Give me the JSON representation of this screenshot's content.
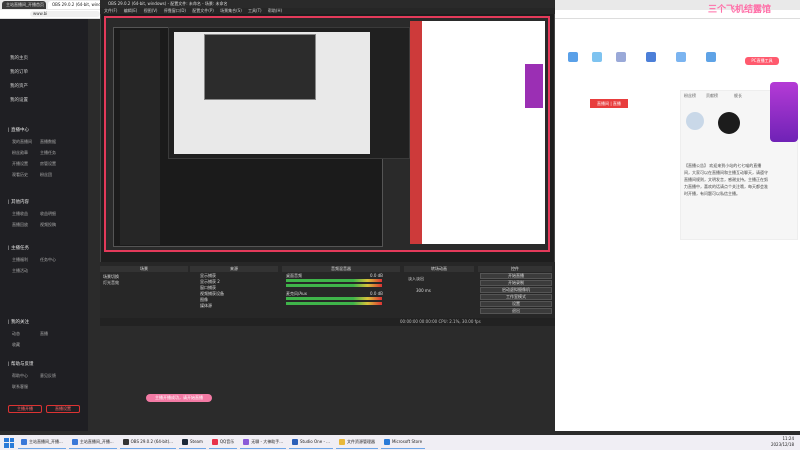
{
  "browser": {
    "tabs": [
      "主站直播间_开播首页",
      "OBS 29.0.2 (64-bit, windows)",
      "3人在线"
    ],
    "url": "www.bi",
    "title": "OBS 29.0.2 (64-bit, windows) - 配置文件: 未命名 - 场景: 未命名"
  },
  "obs_menu": [
    "文件(F)",
    "编辑(E)",
    "视图(V)",
    "停靠窗口(D)",
    "配置文件(P)",
    "场景集合(S)",
    "工具(T)",
    "帮助(H)"
  ],
  "sidebar": {
    "top_items": [
      "我的主页",
      "我的订单",
      "我的资产",
      "我的设置"
    ],
    "sections": [
      {
        "head": "| 直播中心",
        "items": [
          "我的直播间",
          "直播数据",
          "粉丝勋章",
          "主播任务",
          "开播设置",
          "房管设置",
          "观看历史",
          "粉丝团"
        ]
      },
      {
        "head": "| 其他内容",
        "items": [
          "主播收益",
          "收益明细",
          "直播回放",
          "视频投稿"
        ]
      },
      {
        "head": "| 主播任务",
        "items": [
          "主播福利",
          "任务中心",
          "主播活动"
        ]
      },
      {
        "head": "| 我的关注",
        "items": [
          "动态",
          "直播",
          "收藏"
        ]
      },
      {
        "head": "| 帮助与反馈",
        "items": [
          "帮助中心",
          "意见反馈",
          "联系客服"
        ]
      }
    ],
    "buttons": [
      "主播开播",
      "直播设置"
    ]
  },
  "obs_docks": {
    "scenes_head": "场景",
    "scenes": [
      "场景切换",
      "灯光音效"
    ],
    "sources_head": "来源",
    "sources": [
      "显示捕获",
      "显示捕获 2",
      "窗口捕获",
      "视频捕获设备",
      "图像",
      "媒体源"
    ],
    "mixer_head": "音频混音器",
    "mixer": [
      {
        "name": "桌面音频",
        "db": "0.0 dB"
      },
      {
        "name": "麦克风/Aux",
        "db": "0.0 dB"
      }
    ],
    "transition_head": "转场动画",
    "transition_type": "淡入淡出",
    "transition_duration": "300 ms",
    "controls_head": "控件",
    "controls": [
      "开始直播",
      "开始录制",
      "启动虚拟摄像机",
      "工作室模式",
      "设置",
      "退出"
    ],
    "status": "00:00:00  00:00:00  CPU: 2.1%, 30.00 fps"
  },
  "site_right": {
    "record_tag": "直播间 | 直播",
    "pc_button": "PC直播工具",
    "tabs": [
      "粉丝榜",
      "贡献榜",
      "舰长"
    ],
    "description": "【直播公告】 欢迎来到小站的七七喵的直播间，大家可以在直播间和主播互动聊天，请遵守直播间规则，文明发言，感谢支持。主播正在努力直播中，喜欢的话请点个关注哦，每天都会准时开播，有问题可以私信主播。",
    "watermark": "三个飞机结露馆"
  },
  "toast": "主播开播成功，请开始直播",
  "taskbar": {
    "items": [
      "主站直播间_开播...",
      "主站直播间_开播...",
      "OBS 29.0.2 (64-bit)...",
      "Steam",
      "QQ音乐",
      "无聊 - 大神助手...",
      "Studio One - ...",
      "文件资源管理器",
      "Microsoft Store"
    ],
    "time": "11:24",
    "date": "2023/12/18"
  },
  "colors": {
    "obs_border": "#e33a5a",
    "accent_pink": "#ff5a6e",
    "purple": "#9b2fb4"
  }
}
